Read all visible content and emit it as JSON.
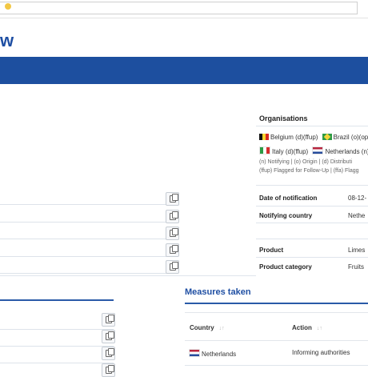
{
  "page": {
    "title": "w"
  },
  "organisations": {
    "title": "Organisations",
    "lines": [
      [
        {
          "flag": "be",
          "text": "Belgium (d)(ffup)"
        },
        {
          "flag": "br",
          "text": "Brazil (o)(op)"
        }
      ],
      [
        {
          "flag": "it",
          "text": "Italy (d)(ffup)"
        },
        {
          "flag": "nl",
          "text": "Netherlands (n)("
        }
      ]
    ],
    "legend_1": "(n) Notifying | (o) Origin | (d) Distributi",
    "legend_2": "(ffup) Flagged for Follow-Up | (ffa) Flagg"
  },
  "details": [
    {
      "label": "Date of notification",
      "value": "08-12-"
    },
    {
      "label": "Notifying country",
      "value": "Nethe"
    },
    {
      "label": "Product",
      "value": "Limes"
    },
    {
      "label": "Product category",
      "value": "Fruits"
    }
  ],
  "measures": {
    "title": "Measures taken",
    "headers": {
      "country": "Country",
      "action": "Action",
      "sort": "↓↑"
    },
    "rows": [
      {
        "flag": "nl",
        "country": "Netherlands",
        "action": "Informing authorities"
      }
    ]
  }
}
